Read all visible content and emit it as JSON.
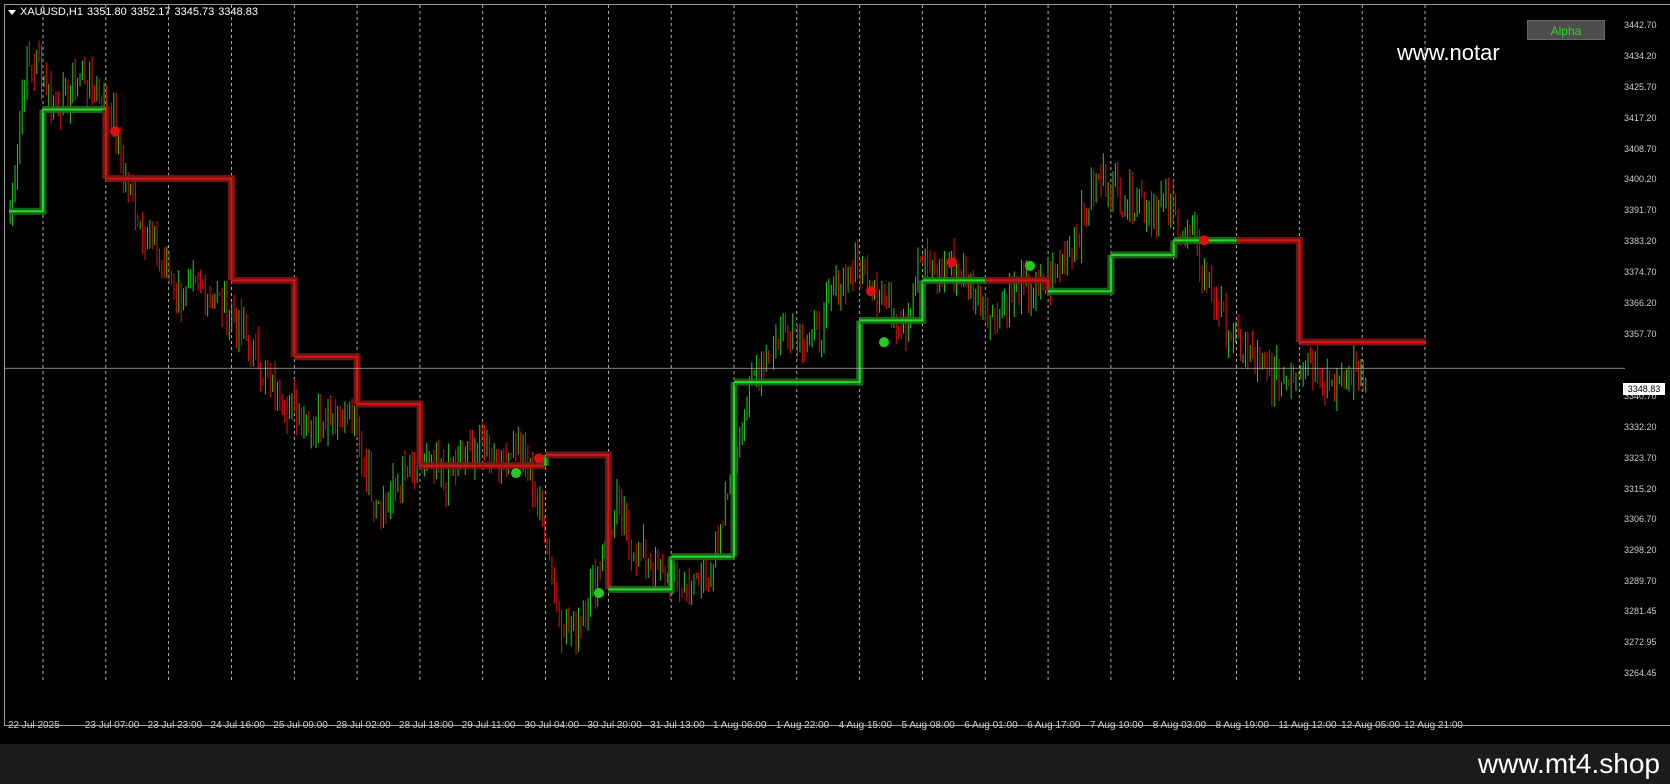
{
  "header": {
    "symbol_timeframe": "XAUUSD,H1",
    "open": "3351.80",
    "high": "3352.17",
    "low": "3345.73",
    "close": "3348.83"
  },
  "panel": {
    "alpha_button_label": "Alpha",
    "watermark_text": "www.notar"
  },
  "footer": {
    "site": "www.mt4.shop"
  },
  "price_axis": {
    "labels": [
      "3442.70",
      "3434.20",
      "3425.70",
      "3417.20",
      "3408.70",
      "3400.20",
      "3391.70",
      "3383.20",
      "3374.70",
      "3366.20",
      "3357.70",
      "3348.83",
      "3340.70",
      "3332.20",
      "3323.70",
      "3315.20",
      "3306.70",
      "3298.20",
      "3289.70",
      "3281.45",
      "3272.95",
      "3264.45"
    ],
    "current_price": "3348.83"
  },
  "time_axis": {
    "labels": [
      "22 Jul 2025",
      "23 Jul 07:00",
      "23 Jul 23:00",
      "24 Jul 16:00",
      "25 Jul 09:00",
      "28 Jul 02:00",
      "28 Jul 18:00",
      "29 Jul 11:00",
      "30 Jul 04:00",
      "30 Jul 20:00",
      "31 Jul 13:00",
      "1 Aug 06:00",
      "1 Aug 22:00",
      "4 Aug 15:00",
      "5 Aug 08:00",
      "6 Aug 01:00",
      "6 Aug 17:00",
      "7 Aug 10:00",
      "8 Aug 03:00",
      "8 Aug 19:00",
      "11 Aug 12:00",
      "12 Aug 05:00",
      "12 Aug 21:00"
    ]
  },
  "colors": {
    "background": "#000000",
    "up_candle": "#22cc22",
    "down_candle": "#dd1111",
    "trend_up": "#22dd22",
    "trend_down": "#dd1111",
    "band_up": "#1e6b1e",
    "band_down": "#7a1a1a",
    "grid": "#ffffff"
  },
  "chart_data": {
    "type": "candlestick",
    "symbol": "XAUUSD",
    "timeframe": "H1",
    "ylim": [
      3264.45,
      3446.0
    ],
    "grid": true,
    "trend_line": [
      {
        "t": "22 Jul 2025",
        "v": 3392,
        "dir": "up"
      },
      {
        "t": "22 Jul 2025",
        "v": 3420,
        "dir": "up"
      },
      {
        "t": "23 Jul 07:00",
        "v": 3420,
        "dir": "up"
      },
      {
        "t": "23 Jul 07:00",
        "v": 3401,
        "dir": "down"
      },
      {
        "t": "24 Jul 16:00",
        "v": 3373,
        "dir": "down"
      },
      {
        "t": "25 Jul 09:00",
        "v": 3352,
        "dir": "down"
      },
      {
        "t": "28 Jul 02:00",
        "v": 3339,
        "dir": "down"
      },
      {
        "t": "28 Jul 18:00",
        "v": 3322,
        "dir": "down"
      },
      {
        "t": "30 Jul 04:00",
        "v": 3322,
        "dir": "down"
      },
      {
        "t": "30 Jul 04:00",
        "v": 3325,
        "dir": "up"
      },
      {
        "t": "30 Jul 20:00",
        "v": 3288,
        "dir": "down"
      },
      {
        "t": "31 Jul 13:00",
        "v": 3297,
        "dir": "up"
      },
      {
        "t": "1 Aug 06:00",
        "v": 3297,
        "dir": "up"
      },
      {
        "t": "1 Aug 06:00",
        "v": 3345,
        "dir": "up"
      },
      {
        "t": "4 Aug 15:00",
        "v": 3362,
        "dir": "up"
      },
      {
        "t": "5 Aug 08:00",
        "v": 3373,
        "dir": "up"
      },
      {
        "t": "6 Aug 01:00",
        "v": 3373,
        "dir": "up"
      },
      {
        "t": "6 Aug 17:00",
        "v": 3370,
        "dir": "down"
      },
      {
        "t": "7 Aug 10:00",
        "v": 3380,
        "dir": "up"
      },
      {
        "t": "8 Aug 03:00",
        "v": 3384,
        "dir": "up"
      },
      {
        "t": "8 Aug 19:00",
        "v": 3384,
        "dir": "up"
      },
      {
        "t": "11 Aug 12:00",
        "v": 3356,
        "dir": "down"
      },
      {
        "t": "12 Aug 21:00",
        "v": 3356,
        "dir": "down"
      }
    ],
    "close_path": [
      3392,
      3430,
      3433,
      3421,
      3424,
      3430,
      3424,
      3420,
      3401,
      3389,
      3381,
      3374,
      3368,
      3371,
      3369,
      3366,
      3359,
      3352,
      3344,
      3340,
      3337,
      3334,
      3337,
      3338,
      3330,
      3316,
      3311,
      3318,
      3320,
      3322,
      3318,
      3322,
      3326,
      3328,
      3322,
      3330,
      3318,
      3305,
      3280,
      3276,
      3285,
      3298,
      3310,
      3300,
      3297,
      3293,
      3290,
      3288,
      3291,
      3298,
      3323,
      3340,
      3352,
      3356,
      3360,
      3358,
      3357,
      3371,
      3375,
      3376,
      3371,
      3365,
      3361,
      3379,
      3375,
      3378,
      3373,
      3368,
      3363,
      3367,
      3371,
      3369,
      3373,
      3380,
      3387,
      3399,
      3401,
      3395,
      3396,
      3393,
      3395,
      3388,
      3383,
      3371,
      3362,
      3355,
      3351,
      3348,
      3345,
      3349,
      3352,
      3347,
      3343,
      3349,
      3349
    ]
  }
}
